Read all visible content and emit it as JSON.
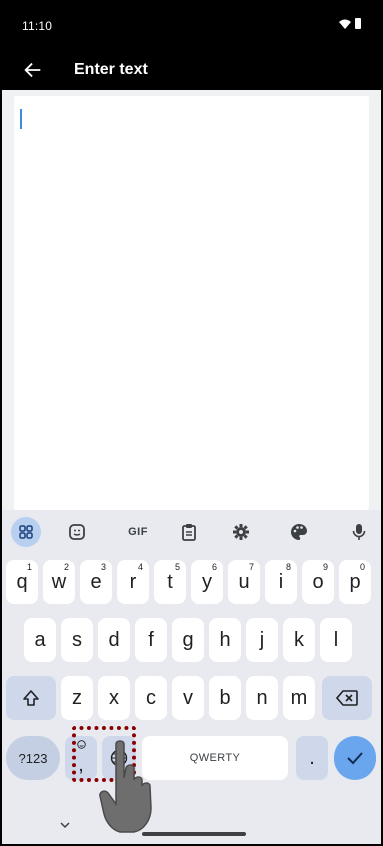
{
  "status_bar": {
    "time": "11:10",
    "wifi_icon": "wifi-icon",
    "battery_icon": "battery-icon"
  },
  "app_bar": {
    "title": "Enter text",
    "back_icon": "arrow-back-icon"
  },
  "editor": {
    "text": ""
  },
  "keyboard": {
    "toolbar": [
      "apps-grid-icon",
      "sticker-icon",
      "GIF",
      "clipboard-icon",
      "settings-gear-icon",
      "palette-icon",
      "mic-icon"
    ],
    "row1": [
      {
        "key": "q",
        "hint": "1"
      },
      {
        "key": "w",
        "hint": "2"
      },
      {
        "key": "e",
        "hint": "3"
      },
      {
        "key": "r",
        "hint": "4"
      },
      {
        "key": "t",
        "hint": "5"
      },
      {
        "key": "y",
        "hint": "6"
      },
      {
        "key": "u",
        "hint": "7"
      },
      {
        "key": "i",
        "hint": "8"
      },
      {
        "key": "o",
        "hint": "9"
      },
      {
        "key": "p",
        "hint": "0"
      }
    ],
    "row2": [
      "a",
      "s",
      "d",
      "f",
      "g",
      "h",
      "j",
      "k",
      "l"
    ],
    "row3": [
      "z",
      "x",
      "c",
      "v",
      "b",
      "n",
      "m"
    ],
    "symbols_label": "?123",
    "comma_label": ",",
    "space_label": "QWERTY",
    "period_label": ".",
    "shift_icon": "shift-icon",
    "backspace_icon": "backspace-icon",
    "globe_icon": "globe-icon",
    "emoji_icon": "emoji-icon",
    "enter_icon": "checkmark-icon",
    "collapse_icon": "chevron-down-icon"
  },
  "annotation": {
    "highlight": "tap-gesture-hand"
  }
}
